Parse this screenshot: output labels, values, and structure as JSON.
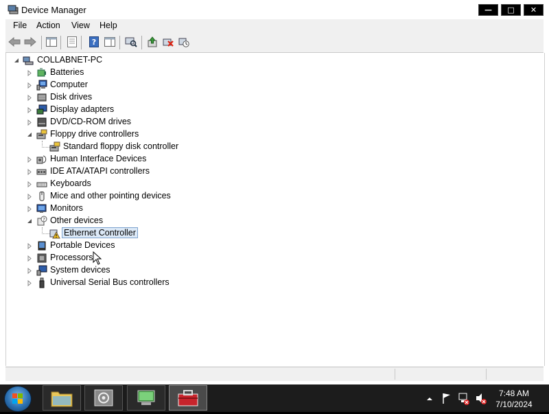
{
  "window": {
    "title": "Device Manager",
    "minimize_label": "—",
    "maximize_label": "□",
    "close_label": "✕"
  },
  "menu": [
    "File",
    "Action",
    "View",
    "Help"
  ],
  "tree": {
    "root": "COLLABNET-PC",
    "items": [
      {
        "label": "Batteries",
        "icon": "battery-icon",
        "expanded": false
      },
      {
        "label": "Computer",
        "icon": "computer-icon",
        "expanded": false
      },
      {
        "label": "Disk drives",
        "icon": "disk-drive-icon",
        "expanded": false
      },
      {
        "label": "Display adapters",
        "icon": "display-adapter-icon",
        "expanded": false
      },
      {
        "label": "DVD/CD-ROM drives",
        "icon": "dvd-drive-icon",
        "expanded": false
      },
      {
        "label": "Floppy drive controllers",
        "icon": "floppy-controller-icon",
        "expanded": true,
        "children": [
          {
            "label": "Standard floppy disk controller",
            "icon": "floppy-controller-icon"
          }
        ]
      },
      {
        "label": "Human Interface Devices",
        "icon": "hid-icon",
        "expanded": false
      },
      {
        "label": "IDE ATA/ATAPI controllers",
        "icon": "ide-controller-icon",
        "expanded": false
      },
      {
        "label": "Keyboards",
        "icon": "keyboard-icon",
        "expanded": false
      },
      {
        "label": "Mice and other pointing devices",
        "icon": "mouse-icon",
        "expanded": false
      },
      {
        "label": "Monitors",
        "icon": "monitor-icon",
        "expanded": false
      },
      {
        "label": "Other devices",
        "icon": "unknown-device-icon",
        "expanded": true,
        "children": [
          {
            "label": "Ethernet Controller",
            "icon": "warning-device-icon",
            "selected": true
          }
        ]
      },
      {
        "label": "Portable Devices",
        "icon": "portable-device-icon",
        "expanded": false
      },
      {
        "label": "Processors",
        "icon": "processor-icon",
        "expanded": false
      },
      {
        "label": "System devices",
        "icon": "system-device-icon",
        "expanded": false
      },
      {
        "label": "Universal Serial Bus controllers",
        "icon": "usb-icon",
        "expanded": false
      }
    ]
  },
  "taskbar": {
    "time": "7:48 AM",
    "date": "7/10/2024"
  },
  "colors": {
    "selection_bg": "#dce9f7",
    "selection_border": "#7da2ce",
    "taskbar_bg": "#1c1c1c"
  }
}
